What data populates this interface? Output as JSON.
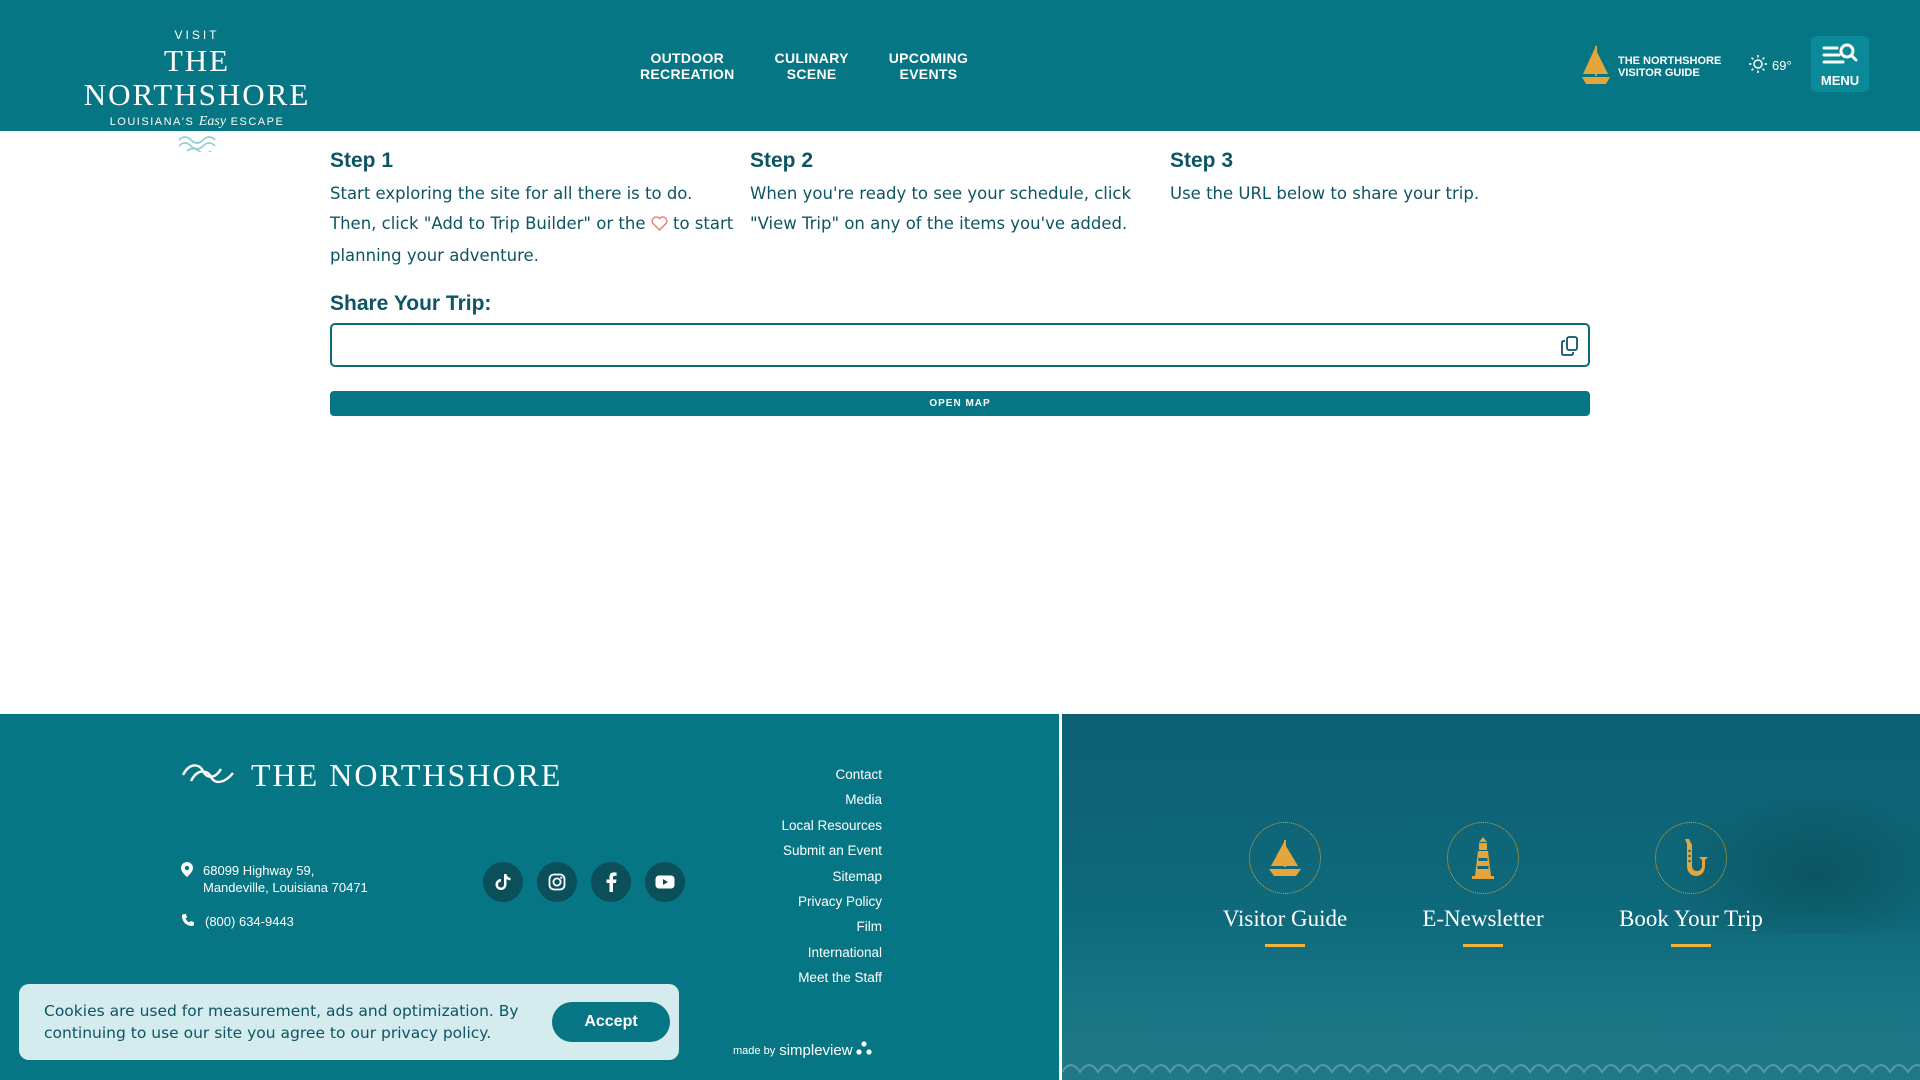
{
  "header": {
    "logo": {
      "visit": "VISIT",
      "name": "THE NORTHSHORE",
      "tagline_pre": "LOUISIANA'S",
      "tagline_script": "Easy",
      "tagline_post": "ESCAPE"
    },
    "nav": [
      {
        "line1": "OUTDOOR",
        "line2": "RECREATION"
      },
      {
        "line1": "CULINARY",
        "line2": "SCENE"
      },
      {
        "line1": "UPCOMING",
        "line2": "EVENTS"
      }
    ],
    "guide": {
      "line1": "THE NORTHSHORE",
      "line2": "VISITOR GUIDE",
      "icon": "sailboat-icon"
    },
    "weather": {
      "temp": "69°",
      "icon": "sun-icon"
    },
    "menu_label": "MENU"
  },
  "steps": [
    {
      "title": "Step 1",
      "text_before": "Start exploring the site for all there is to do. Then, click \"Add to Trip Builder\" or the",
      "text_after": "to start planning your adventure."
    },
    {
      "title": "Step 2",
      "text": "When you're ready to see your schedule, click \"View Trip\" on any of the items you've added."
    },
    {
      "title": "Step 3",
      "text": "Use the URL below to share your trip."
    }
  ],
  "share": {
    "title": "Share Your Trip:",
    "url_value": "",
    "open_map_label": "OPEN MAP"
  },
  "footer": {
    "logo_name": "THE NORTHSHORE",
    "address_line1": "68099 Highway 59,",
    "address_line2": "Mandeville, Louisiana 70471",
    "phone": "(800) 634-9443",
    "socials": [
      "tiktok-icon",
      "instagram-icon",
      "facebook-icon",
      "youtube-icon"
    ],
    "links": [
      "Contact",
      "Media",
      "Local Resources",
      "Submit an Event",
      "Sitemap",
      "Privacy Policy",
      "Film",
      "International",
      "Meet the Staff"
    ],
    "madeby_small": "made by",
    "madeby_brand": "simpleview",
    "features": [
      {
        "label": "Visitor Guide",
        "icon": "sailboat-icon"
      },
      {
        "label": "E-Newsletter",
        "icon": "lighthouse-icon"
      },
      {
        "label": "Book Your Trip",
        "icon": "saxophone-icon"
      }
    ]
  },
  "cookie": {
    "message": "Cookies are used for measurement, ads and optimization. By continuing to use our site you agree to our privacy policy.",
    "accept_label": "Accept"
  },
  "colors": {
    "brand_teal": "#067684",
    "text_dark_teal": "#0d5562",
    "accent_gold": "#f0b540",
    "heart": "#e8836f"
  }
}
